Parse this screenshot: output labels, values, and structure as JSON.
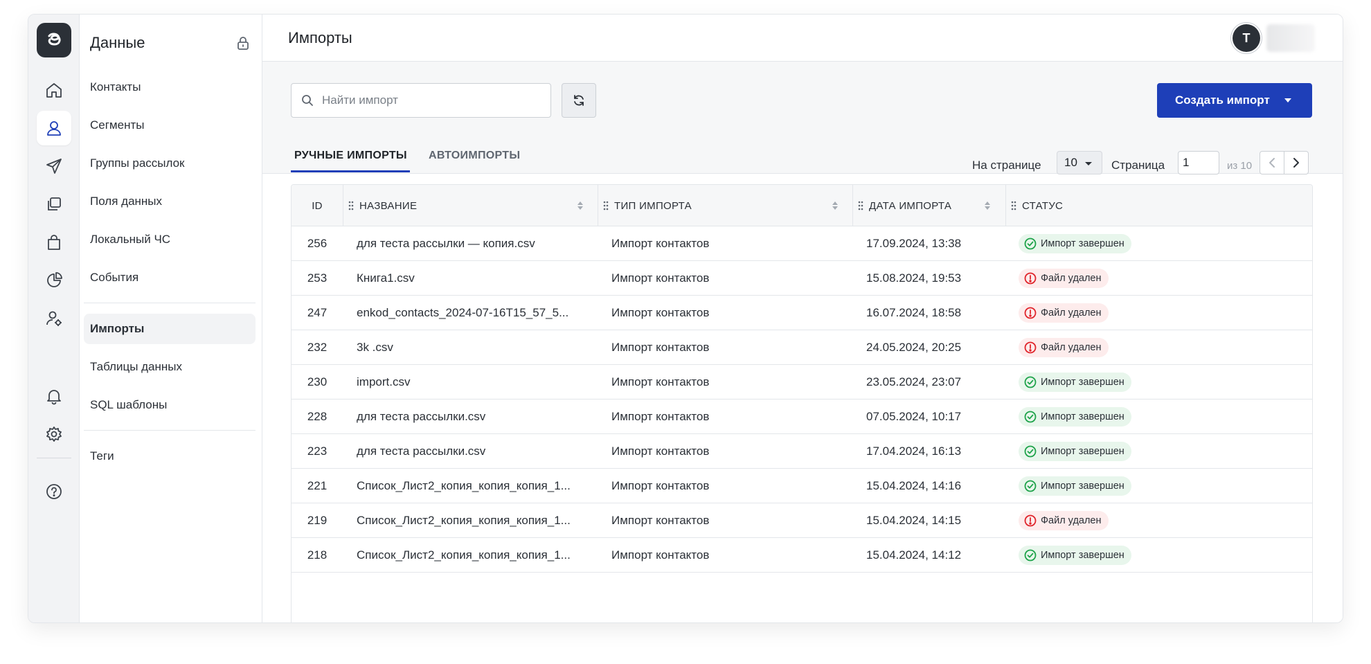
{
  "colors": {
    "accent": "#1e3fb8",
    "success": "#1ea34a",
    "error": "#e0242b"
  },
  "sidebar": {
    "title": "Данные",
    "group1": [
      {
        "label": "Контакты"
      },
      {
        "label": "Сегменты"
      },
      {
        "label": "Группы рассылок"
      },
      {
        "label": "Поля данных"
      },
      {
        "label": "Локальный ЧС"
      },
      {
        "label": "События"
      }
    ],
    "group2": [
      {
        "label": "Импорты"
      },
      {
        "label": "Таблицы данных"
      },
      {
        "label": "SQL шаблоны"
      }
    ],
    "group3": [
      {
        "label": "Теги"
      }
    ]
  },
  "header": {
    "title": "Импорты",
    "avatar_letter": "T"
  },
  "toolbar": {
    "search_placeholder": "Найти импорт",
    "create_label": "Создать импорт"
  },
  "tabs": [
    {
      "label": "РУЧНЫЕ ИМПОРТЫ"
    },
    {
      "label": "АВТОИМПОРТЫ"
    }
  ],
  "pagination": {
    "per_page_label": "На странице",
    "per_page_value": "10",
    "page_label": "Страница",
    "page_value": "1",
    "page_of": "из 10"
  },
  "table": {
    "columns": {
      "id": "ID",
      "name": "НАЗВАНИЕ",
      "type": "ТИП ИМПОРТА",
      "date": "ДАТА ИМПОРТА",
      "status": "СТАТУС"
    },
    "rows": [
      {
        "id": "256",
        "name": "для теста рассылки — копия.csv",
        "type": "Импорт контактов",
        "date": "17.09.2024, 13:38",
        "status": "Импорт завершен",
        "ok": true
      },
      {
        "id": "253",
        "name": "Книга1.csv",
        "type": "Импорт контактов",
        "date": "15.08.2024, 19:53",
        "status": "Файл удален",
        "ok": false
      },
      {
        "id": "247",
        "name": "enkod_contacts_2024-07-16T15_57_5...",
        "type": "Импорт контактов",
        "date": "16.07.2024, 18:58",
        "status": "Файл удален",
        "ok": false
      },
      {
        "id": "232",
        "name": "3k .csv",
        "type": "Импорт контактов",
        "date": "24.05.2024, 20:25",
        "status": "Файл удален",
        "ok": false
      },
      {
        "id": "230",
        "name": "import.csv",
        "type": "Импорт контактов",
        "date": "23.05.2024, 23:07",
        "status": "Импорт завершен",
        "ok": true
      },
      {
        "id": "228",
        "name": "для теста рассылки.csv",
        "type": "Импорт контактов",
        "date": "07.05.2024, 10:17",
        "status": "Импорт завершен",
        "ok": true
      },
      {
        "id": "223",
        "name": "для теста рассылки.csv",
        "type": "Импорт контактов",
        "date": "17.04.2024, 16:13",
        "status": "Импорт завершен",
        "ok": true
      },
      {
        "id": "221",
        "name": "Список_Лист2_копия_копия_копия_1...",
        "type": "Импорт контактов",
        "date": "15.04.2024, 14:16",
        "status": "Импорт завершен",
        "ok": true
      },
      {
        "id": "219",
        "name": "Список_Лист2_копия_копия_копия_1...",
        "type": "Импорт контактов",
        "date": "15.04.2024, 14:15",
        "status": "Файл удален",
        "ok": false
      },
      {
        "id": "218",
        "name": "Список_Лист2_копия_копия_копия_1...",
        "type": "Импорт контактов",
        "date": "15.04.2024, 14:12",
        "status": "Импорт завершен",
        "ok": true
      }
    ]
  }
}
